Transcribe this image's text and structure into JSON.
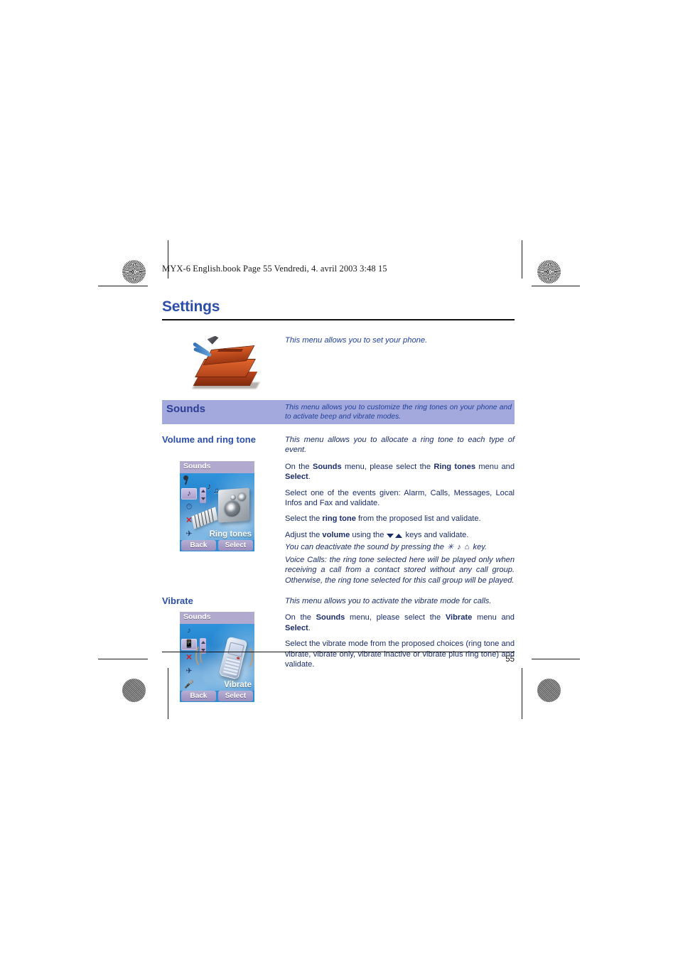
{
  "print_header": "MYX-6 English.book  Page 55  Vendredi, 4. avril 2003  3:48 15",
  "page": {
    "title": "Settings",
    "number": "55",
    "intro": "This menu allows you to set your phone."
  },
  "band": {
    "title": "Sounds",
    "description": "This menu allows you to customize the ring tones on your phone and to activate beep and vibrate modes."
  },
  "sections": [
    {
      "heading": "Volume and ring tone",
      "intro": "This menu allows you to allocate a ring tone to each type of event.",
      "p1_a": "On the ",
      "p1_b": "Sounds",
      "p1_c": " menu, please select the ",
      "p1_d": "Ring tones",
      "p1_e": " menu and ",
      "p1_f": "Select",
      "p1_g": ".",
      "p2": "Select one of the events given: Alarm, Calls, Messages, Local Infos and Fax and validate.",
      "p3_a": "Select the ",
      "p3_b": "ring tone",
      "p3_c": " from the proposed list and validate.",
      "p4_a": "Adjust the ",
      "p4_b": "volume",
      "p4_c": " using the ",
      "p4_d": " keys and validate.",
      "note_a": "You can deactivate the sound by pressing the ",
      "note_key": "✳ ♪ ⌂",
      "note_b": " key.",
      "note_c": "Voice Calls: the ring tone selected here will be played only when receiving a call from a contact stored without any call group. Otherwise, the ring tone selected for this call group will be played.",
      "screen": {
        "title": "Sounds",
        "label": "Ring tones",
        "softkey_left": "Back",
        "softkey_right": "Select"
      }
    },
    {
      "heading": "Vibrate",
      "intro": "This menu allows you to activate the vibrate mode for calls.",
      "p1_a": "On the ",
      "p1_b": "Sounds",
      "p1_c": " menu, please select the ",
      "p1_d": "Vibrate",
      "p1_e": " menu and ",
      "p1_f": "Select",
      "p1_g": ".",
      "p2": "Select the vibrate mode from the proposed choices (ring tone and vibrate, vibrate only, vibrate inactive or vibrate plus ring tone) and validate.",
      "screen": {
        "title": "Sounds",
        "label": "Vibrate",
        "softkey_left": "Back",
        "softkey_right": "Select"
      }
    }
  ],
  "colors": {
    "heading_blue": "#2b4eaa",
    "body_blue": "#1b2c6b",
    "band_bg": "#a3a9dd",
    "screen_blue": "#2b8fd6",
    "softkey_lavender": "#a79bc9"
  }
}
